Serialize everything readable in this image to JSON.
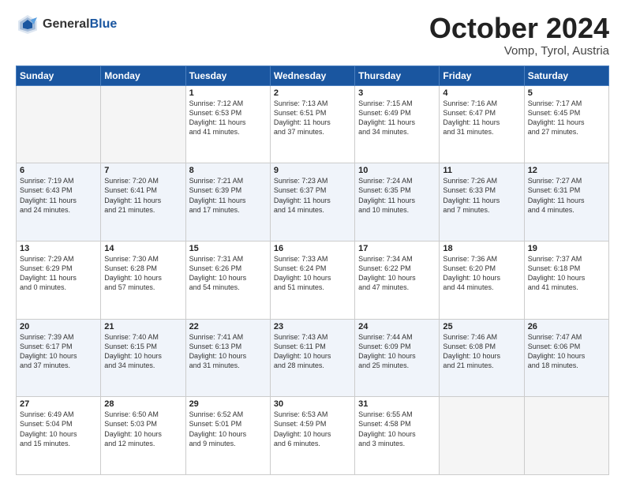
{
  "header": {
    "logo_general": "General",
    "logo_blue": "Blue",
    "month_title": "October 2024",
    "location": "Vomp, Tyrol, Austria"
  },
  "weekdays": [
    "Sunday",
    "Monday",
    "Tuesday",
    "Wednesday",
    "Thursday",
    "Friday",
    "Saturday"
  ],
  "weeks": [
    [
      {
        "day": "",
        "info": "",
        "empty": true
      },
      {
        "day": "",
        "info": "",
        "empty": true
      },
      {
        "day": "1",
        "info": "Sunrise: 7:12 AM\nSunset: 6:53 PM\nDaylight: 11 hours\nand 41 minutes.",
        "empty": false
      },
      {
        "day": "2",
        "info": "Sunrise: 7:13 AM\nSunset: 6:51 PM\nDaylight: 11 hours\nand 37 minutes.",
        "empty": false
      },
      {
        "day": "3",
        "info": "Sunrise: 7:15 AM\nSunset: 6:49 PM\nDaylight: 11 hours\nand 34 minutes.",
        "empty": false
      },
      {
        "day": "4",
        "info": "Sunrise: 7:16 AM\nSunset: 6:47 PM\nDaylight: 11 hours\nand 31 minutes.",
        "empty": false
      },
      {
        "day": "5",
        "info": "Sunrise: 7:17 AM\nSunset: 6:45 PM\nDaylight: 11 hours\nand 27 minutes.",
        "empty": false
      }
    ],
    [
      {
        "day": "6",
        "info": "Sunrise: 7:19 AM\nSunset: 6:43 PM\nDaylight: 11 hours\nand 24 minutes.",
        "empty": false
      },
      {
        "day": "7",
        "info": "Sunrise: 7:20 AM\nSunset: 6:41 PM\nDaylight: 11 hours\nand 21 minutes.",
        "empty": false
      },
      {
        "day": "8",
        "info": "Sunrise: 7:21 AM\nSunset: 6:39 PM\nDaylight: 11 hours\nand 17 minutes.",
        "empty": false
      },
      {
        "day": "9",
        "info": "Sunrise: 7:23 AM\nSunset: 6:37 PM\nDaylight: 11 hours\nand 14 minutes.",
        "empty": false
      },
      {
        "day": "10",
        "info": "Sunrise: 7:24 AM\nSunset: 6:35 PM\nDaylight: 11 hours\nand 10 minutes.",
        "empty": false
      },
      {
        "day": "11",
        "info": "Sunrise: 7:26 AM\nSunset: 6:33 PM\nDaylight: 11 hours\nand 7 minutes.",
        "empty": false
      },
      {
        "day": "12",
        "info": "Sunrise: 7:27 AM\nSunset: 6:31 PM\nDaylight: 11 hours\nand 4 minutes.",
        "empty": false
      }
    ],
    [
      {
        "day": "13",
        "info": "Sunrise: 7:29 AM\nSunset: 6:29 PM\nDaylight: 11 hours\nand 0 minutes.",
        "empty": false
      },
      {
        "day": "14",
        "info": "Sunrise: 7:30 AM\nSunset: 6:28 PM\nDaylight: 10 hours\nand 57 minutes.",
        "empty": false
      },
      {
        "day": "15",
        "info": "Sunrise: 7:31 AM\nSunset: 6:26 PM\nDaylight: 10 hours\nand 54 minutes.",
        "empty": false
      },
      {
        "day": "16",
        "info": "Sunrise: 7:33 AM\nSunset: 6:24 PM\nDaylight: 10 hours\nand 51 minutes.",
        "empty": false
      },
      {
        "day": "17",
        "info": "Sunrise: 7:34 AM\nSunset: 6:22 PM\nDaylight: 10 hours\nand 47 minutes.",
        "empty": false
      },
      {
        "day": "18",
        "info": "Sunrise: 7:36 AM\nSunset: 6:20 PM\nDaylight: 10 hours\nand 44 minutes.",
        "empty": false
      },
      {
        "day": "19",
        "info": "Sunrise: 7:37 AM\nSunset: 6:18 PM\nDaylight: 10 hours\nand 41 minutes.",
        "empty": false
      }
    ],
    [
      {
        "day": "20",
        "info": "Sunrise: 7:39 AM\nSunset: 6:17 PM\nDaylight: 10 hours\nand 37 minutes.",
        "empty": false
      },
      {
        "day": "21",
        "info": "Sunrise: 7:40 AM\nSunset: 6:15 PM\nDaylight: 10 hours\nand 34 minutes.",
        "empty": false
      },
      {
        "day": "22",
        "info": "Sunrise: 7:41 AM\nSunset: 6:13 PM\nDaylight: 10 hours\nand 31 minutes.",
        "empty": false
      },
      {
        "day": "23",
        "info": "Sunrise: 7:43 AM\nSunset: 6:11 PM\nDaylight: 10 hours\nand 28 minutes.",
        "empty": false
      },
      {
        "day": "24",
        "info": "Sunrise: 7:44 AM\nSunset: 6:09 PM\nDaylight: 10 hours\nand 25 minutes.",
        "empty": false
      },
      {
        "day": "25",
        "info": "Sunrise: 7:46 AM\nSunset: 6:08 PM\nDaylight: 10 hours\nand 21 minutes.",
        "empty": false
      },
      {
        "day": "26",
        "info": "Sunrise: 7:47 AM\nSunset: 6:06 PM\nDaylight: 10 hours\nand 18 minutes.",
        "empty": false
      }
    ],
    [
      {
        "day": "27",
        "info": "Sunrise: 6:49 AM\nSunset: 5:04 PM\nDaylight: 10 hours\nand 15 minutes.",
        "empty": false
      },
      {
        "day": "28",
        "info": "Sunrise: 6:50 AM\nSunset: 5:03 PM\nDaylight: 10 hours\nand 12 minutes.",
        "empty": false
      },
      {
        "day": "29",
        "info": "Sunrise: 6:52 AM\nSunset: 5:01 PM\nDaylight: 10 hours\nand 9 minutes.",
        "empty": false
      },
      {
        "day": "30",
        "info": "Sunrise: 6:53 AM\nSunset: 4:59 PM\nDaylight: 10 hours\nand 6 minutes.",
        "empty": false
      },
      {
        "day": "31",
        "info": "Sunrise: 6:55 AM\nSunset: 4:58 PM\nDaylight: 10 hours\nand 3 minutes.",
        "empty": false
      },
      {
        "day": "",
        "info": "",
        "empty": true
      },
      {
        "day": "",
        "info": "",
        "empty": true
      }
    ]
  ]
}
